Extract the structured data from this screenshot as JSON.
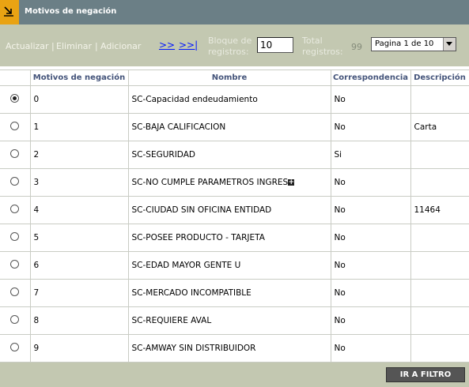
{
  "title_bar": {
    "icon": "arrow-corner-icon",
    "title": "Motivos de negación"
  },
  "toolbar": {
    "actualizar": "Actualizar",
    "eliminar": "Eliminar",
    "adicionar": "Adicionar",
    "separator": "|",
    "next_link": ">>",
    "last_link": ">>|",
    "bloque_label_1": "Bloque de",
    "bloque_label_2": "registros:",
    "bloque_value": "10",
    "total_label_1": "Total",
    "total_label_2": "registros:",
    "total_value": "99",
    "page_select_value": "Pagina 1 de 10"
  },
  "table": {
    "headers": [
      "",
      "Motivos de negación",
      "Nombre",
      "Correspondencia",
      "Descripción"
    ],
    "rows": [
      {
        "selected": true,
        "motivo": "0",
        "nombre": "SC-Capacidad endeudamiento",
        "correspondencia": "No",
        "descripcion": ""
      },
      {
        "selected": false,
        "motivo": "1",
        "nombre": "SC-BAJA CALIFICACION",
        "correspondencia": "No",
        "descripcion": "Carta"
      },
      {
        "selected": false,
        "motivo": "2",
        "nombre": "SC-SEGURIDAD",
        "correspondencia": "Si",
        "descripcion": ""
      },
      {
        "selected": false,
        "motivo": "3",
        "nombre": "SC-NO CUMPLE PARAMETROS INGRES",
        "correspondencia": "No",
        "descripcion": ""
      },
      {
        "selected": false,
        "motivo": "4",
        "nombre": "SC-CIUDAD SIN OFICINA ENTIDAD",
        "correspondencia": "No",
        "descripcion": "11464"
      },
      {
        "selected": false,
        "motivo": "5",
        "nombre": "SC-POSEE PRODUCTO - TARJETA",
        "correspondencia": "No",
        "descripcion": ""
      },
      {
        "selected": false,
        "motivo": "6",
        "nombre": "SC-EDAD MAYOR GENTE U",
        "correspondencia": "No",
        "descripcion": ""
      },
      {
        "selected": false,
        "motivo": "7",
        "nombre": "SC-MERCADO INCOMPATIBLE",
        "correspondencia": "No",
        "descripcion": ""
      },
      {
        "selected": false,
        "motivo": "8",
        "nombre": "SC-REQUIERE AVAL",
        "correspondencia": "No",
        "descripcion": ""
      },
      {
        "selected": false,
        "motivo": "9",
        "nombre": "SC-AMWAY SIN DISTRIBUIDOR",
        "correspondencia": "No",
        "descripcion": ""
      }
    ],
    "expand_icon_row": 3
  },
  "footer": {
    "filter_button": "IR A FILTRO"
  },
  "colors": {
    "title_bg": "#6b7f86",
    "toolbar_bg": "#c3c8b1",
    "header_text": "#44547a",
    "accent_icon": "#e9a313",
    "link_blue": "#0015ff"
  }
}
